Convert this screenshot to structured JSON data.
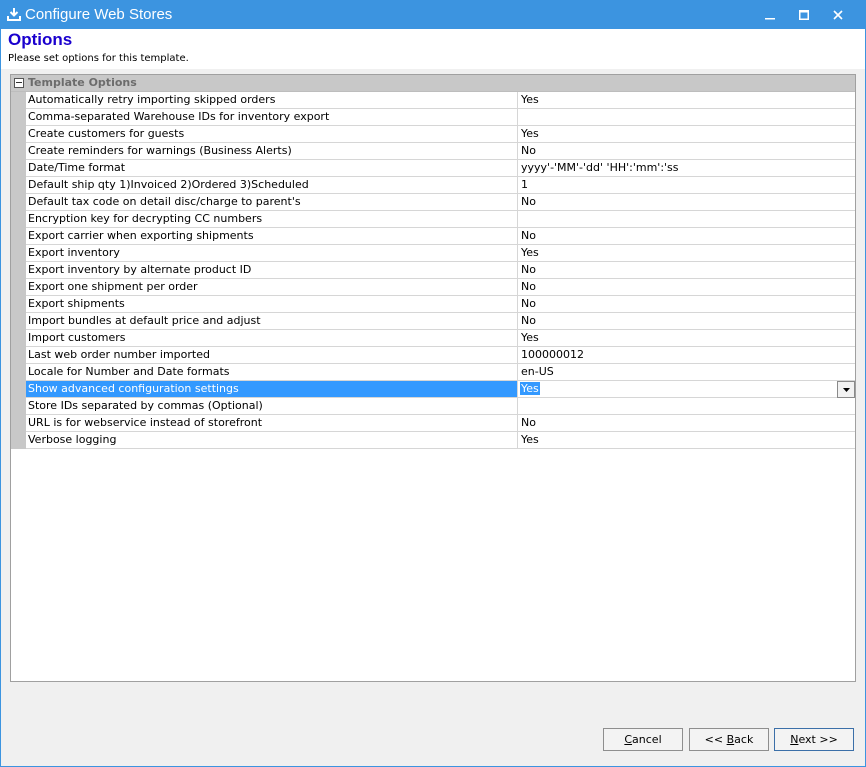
{
  "window": {
    "title": "Configure Web Stores",
    "controls": {
      "minimize": "minimize",
      "maximize": "maximize",
      "close": "close"
    }
  },
  "header": {
    "title": "Options",
    "subtitle": "Please set options for this template."
  },
  "grid": {
    "category": "Template Options",
    "properties": [
      {
        "name": "Automatically retry importing skipped orders",
        "value": "Yes"
      },
      {
        "name": "Comma-separated Warehouse IDs for inventory export",
        "value": ""
      },
      {
        "name": "Create customers for guests",
        "value": "Yes"
      },
      {
        "name": "Create reminders for warnings (Business Alerts)",
        "value": "No"
      },
      {
        "name": "Date/Time format",
        "value": "yyyy'-'MM'-'dd' 'HH':'mm':'ss"
      },
      {
        "name": "Default ship qty 1)Invoiced 2)Ordered 3)Scheduled",
        "value": "1"
      },
      {
        "name": "Default tax code on detail disc/charge to parent's",
        "value": "No"
      },
      {
        "name": "Encryption key for decrypting CC numbers",
        "value": ""
      },
      {
        "name": "Export carrier when exporting shipments",
        "value": "No"
      },
      {
        "name": "Export inventory",
        "value": "Yes"
      },
      {
        "name": "Export inventory by alternate product ID",
        "value": "No"
      },
      {
        "name": "Export one shipment per order",
        "value": "No"
      },
      {
        "name": "Export shipments",
        "value": "No"
      },
      {
        "name": "Import bundles at default price and adjust",
        "value": "No"
      },
      {
        "name": "Import customers",
        "value": "Yes"
      },
      {
        "name": "Last web order number imported",
        "value": "100000012"
      },
      {
        "name": "Locale for Number and Date formats",
        "value": "en-US"
      },
      {
        "name": "Show advanced configuration settings",
        "value": "Yes",
        "selected": true
      },
      {
        "name": "Store IDs separated by commas (Optional)",
        "value": ""
      },
      {
        "name": "URL is for webservice instead of storefront",
        "value": "No"
      },
      {
        "name": "Verbose logging",
        "value": "Yes"
      }
    ]
  },
  "buttons": {
    "cancel": {
      "accel": "C",
      "rest": "ancel"
    },
    "back": {
      "pre": "<< ",
      "accel": "B",
      "rest": "ack"
    },
    "next": {
      "accel": "N",
      "rest": "ext >>"
    }
  },
  "colors": {
    "titlebar": "#3c94e0",
    "heading": "#1a00ce",
    "selection": "#3399ff",
    "category_band": "#c8c8c8"
  },
  "icons": {
    "app": "download-tray-icon",
    "expander": "collapse-minus-icon",
    "dropdown": "chevron-down-icon"
  }
}
